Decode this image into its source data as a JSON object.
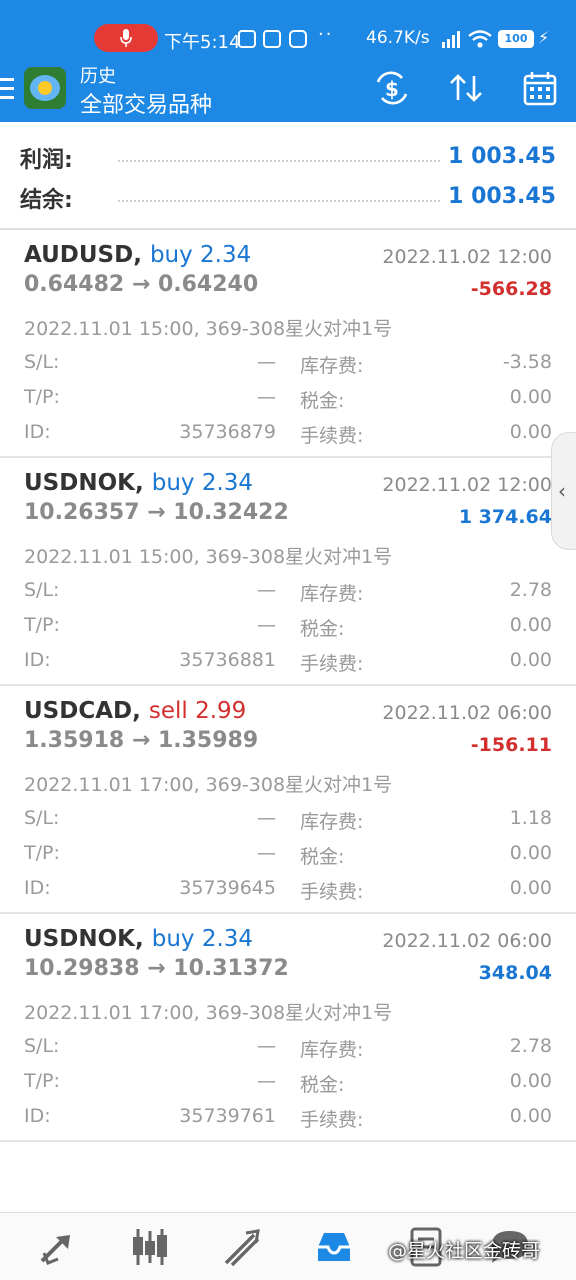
{
  "status_bar": {
    "time": "下午5:14",
    "dots": "··",
    "network_speed": "46.7K/s",
    "battery": "100",
    "bolt": "⚡"
  },
  "app_bar": {
    "title": "历史",
    "subtitle": "全部交易品种"
  },
  "summary": {
    "profit_label": "利润:",
    "profit_value": "1 003.45",
    "balance_label": "结余:",
    "balance_value": "1 003.45"
  },
  "deals": [
    {
      "symbol": "AUDUSD,",
      "side": "buy 2.34",
      "prices": "0.64482 → 0.64240",
      "close_time": "2022.11.02 12:00",
      "profit": "-566.28",
      "open_info": "2022.11.01 15:00, 369-308星火对冲1号",
      "sl_label": "S/L:",
      "sl_value": "—",
      "tp_label": "T/P:",
      "tp_value": "—",
      "id_label": "ID:",
      "id_value": "35736879",
      "swap_label": "库存费:",
      "swap_value": "-3.58",
      "tax_label": "税金:",
      "tax_value": "0.00",
      "fee_label": "手续费:",
      "fee_value": "0.00"
    },
    {
      "symbol": "USDNOK,",
      "side": "buy 2.34",
      "prices": "10.26357 → 10.32422",
      "close_time": "2022.11.02 12:00",
      "profit": "1 374.64",
      "open_info": "2022.11.01 15:00, 369-308星火对冲1号",
      "sl_label": "S/L:",
      "sl_value": "—",
      "tp_label": "T/P:",
      "tp_value": "—",
      "id_label": "ID:",
      "id_value": "35736881",
      "swap_label": "库存费:",
      "swap_value": "2.78",
      "tax_label": "税金:",
      "tax_value": "0.00",
      "fee_label": "手续费:",
      "fee_value": "0.00"
    },
    {
      "symbol": "USDCAD,",
      "side": "sell 2.99",
      "prices": "1.35918 → 1.35989",
      "close_time": "2022.11.02 06:00",
      "profit": "-156.11",
      "open_info": "2022.11.01 17:00, 369-308星火对冲1号",
      "sl_label": "S/L:",
      "sl_value": "—",
      "tp_label": "T/P:",
      "tp_value": "—",
      "id_label": "ID:",
      "id_value": "35739645",
      "swap_label": "库存费:",
      "swap_value": "1.18",
      "tax_label": "税金:",
      "tax_value": "0.00",
      "fee_label": "手续费:",
      "fee_value": "0.00"
    },
    {
      "symbol": "USDNOK,",
      "side": "buy 2.34",
      "prices": "10.29838 → 10.31372",
      "close_time": "2022.11.02 06:00",
      "profit": "348.04",
      "open_info": "2022.11.01 17:00, 369-308星火对冲1号",
      "sl_label": "S/L:",
      "sl_value": "—",
      "tp_label": "T/P:",
      "tp_value": "—",
      "id_label": "ID:",
      "id_value": "35739761",
      "swap_label": "库存费:",
      "swap_value": "2.78",
      "tax_label": "税金:",
      "tax_value": "0.00",
      "fee_label": "手续费:",
      "fee_value": "0.00"
    }
  ],
  "side_handle": {
    "glyph": "‹"
  },
  "watermark": "@星火社区金砖哥",
  "colors": {
    "primary": "#1e88e5",
    "profit_positive": "#1976d2",
    "profit_negative": "#d32f2f"
  }
}
